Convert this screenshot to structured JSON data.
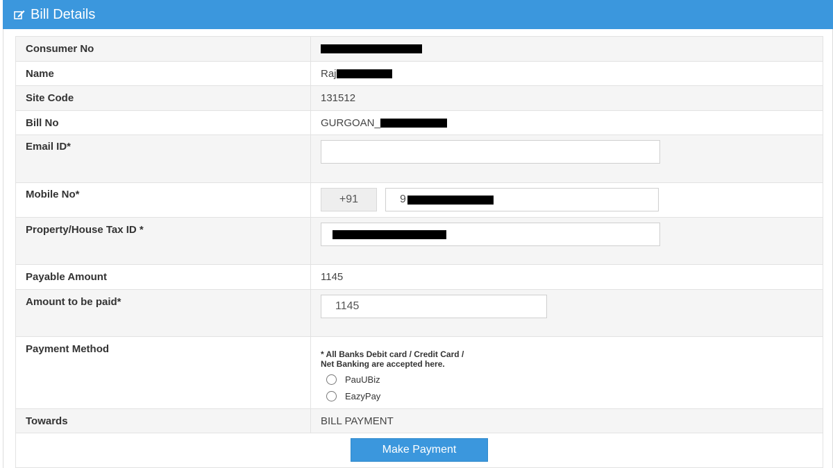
{
  "header": {
    "title": "Bill Details",
    "icon": "edit-icon"
  },
  "fields": {
    "consumer_no": {
      "label": "Consumer No",
      "value": ""
    },
    "name": {
      "label": "Name",
      "value": "Raj"
    },
    "site_code": {
      "label": "Site Code",
      "value": "131512"
    },
    "bill_no": {
      "label": "Bill No",
      "value": "GURGOAN_"
    },
    "email": {
      "label": "Email ID*",
      "value": ""
    },
    "mobile": {
      "label": "Mobile No*",
      "prefix": "+91",
      "value": "9"
    },
    "property_tax": {
      "label": "Property/House Tax ID *",
      "value": ""
    },
    "payable_amount": {
      "label": "Payable Amount",
      "value": "1145"
    },
    "amount_to_pay": {
      "label": "Amount to be paid*",
      "value": "1145"
    },
    "payment_method": {
      "label": "Payment Method",
      "note_line1": "* All Banks Debit card / Credit Card /",
      "note_line2": "Net Banking are accepted here.",
      "options": [
        "PauUBiz",
        "EazyPay"
      ]
    },
    "towards": {
      "label": "Towards",
      "value": "BILL PAYMENT"
    }
  },
  "actions": {
    "submit_label": "Make Payment"
  },
  "colors": {
    "accent": "#3b97dd",
    "row_shade": "#f5f5f5",
    "redaction": "#000000"
  }
}
